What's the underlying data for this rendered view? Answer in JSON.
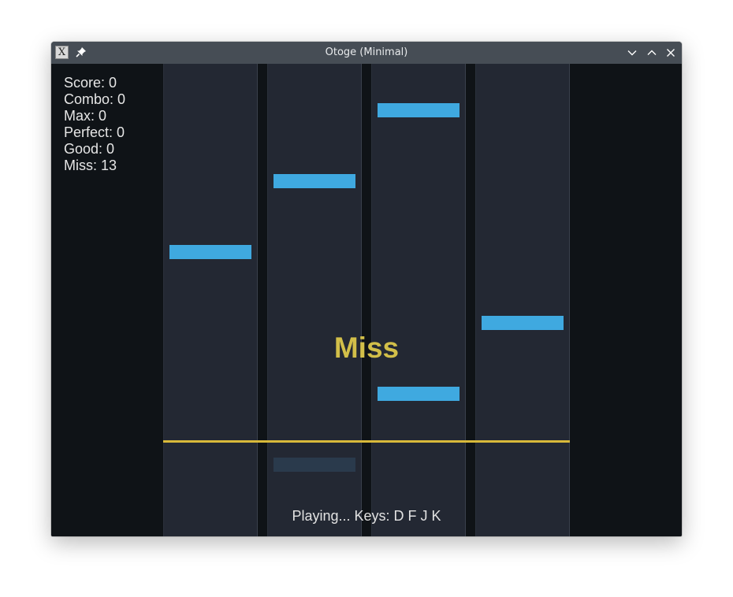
{
  "window": {
    "title": "Otoge (Minimal)",
    "app_icon": "x-app-icon",
    "pin_icon": "pin-icon",
    "controls": [
      "minimize-icon",
      "maximize-icon",
      "close-icon"
    ]
  },
  "hud": {
    "score": "Score: 0",
    "combo": "Combo: 0",
    "max": "Max: 0",
    "perfect": "Perfect: 0",
    "good": "Good: 0",
    "miss": "Miss: 13"
  },
  "judgement": "Miss",
  "status": "Playing... Keys: D F J K",
  "colors": {
    "background": "#0f1317",
    "lane": "#232833",
    "note": "#3fa9e0",
    "judge_line": "#d8b93a",
    "judgement_text": "#d2bf49",
    "titlebar": "#464d55"
  },
  "lanes": [
    {
      "key": "D"
    },
    {
      "key": "F"
    },
    {
      "key": "J"
    },
    {
      "key": "K"
    }
  ]
}
